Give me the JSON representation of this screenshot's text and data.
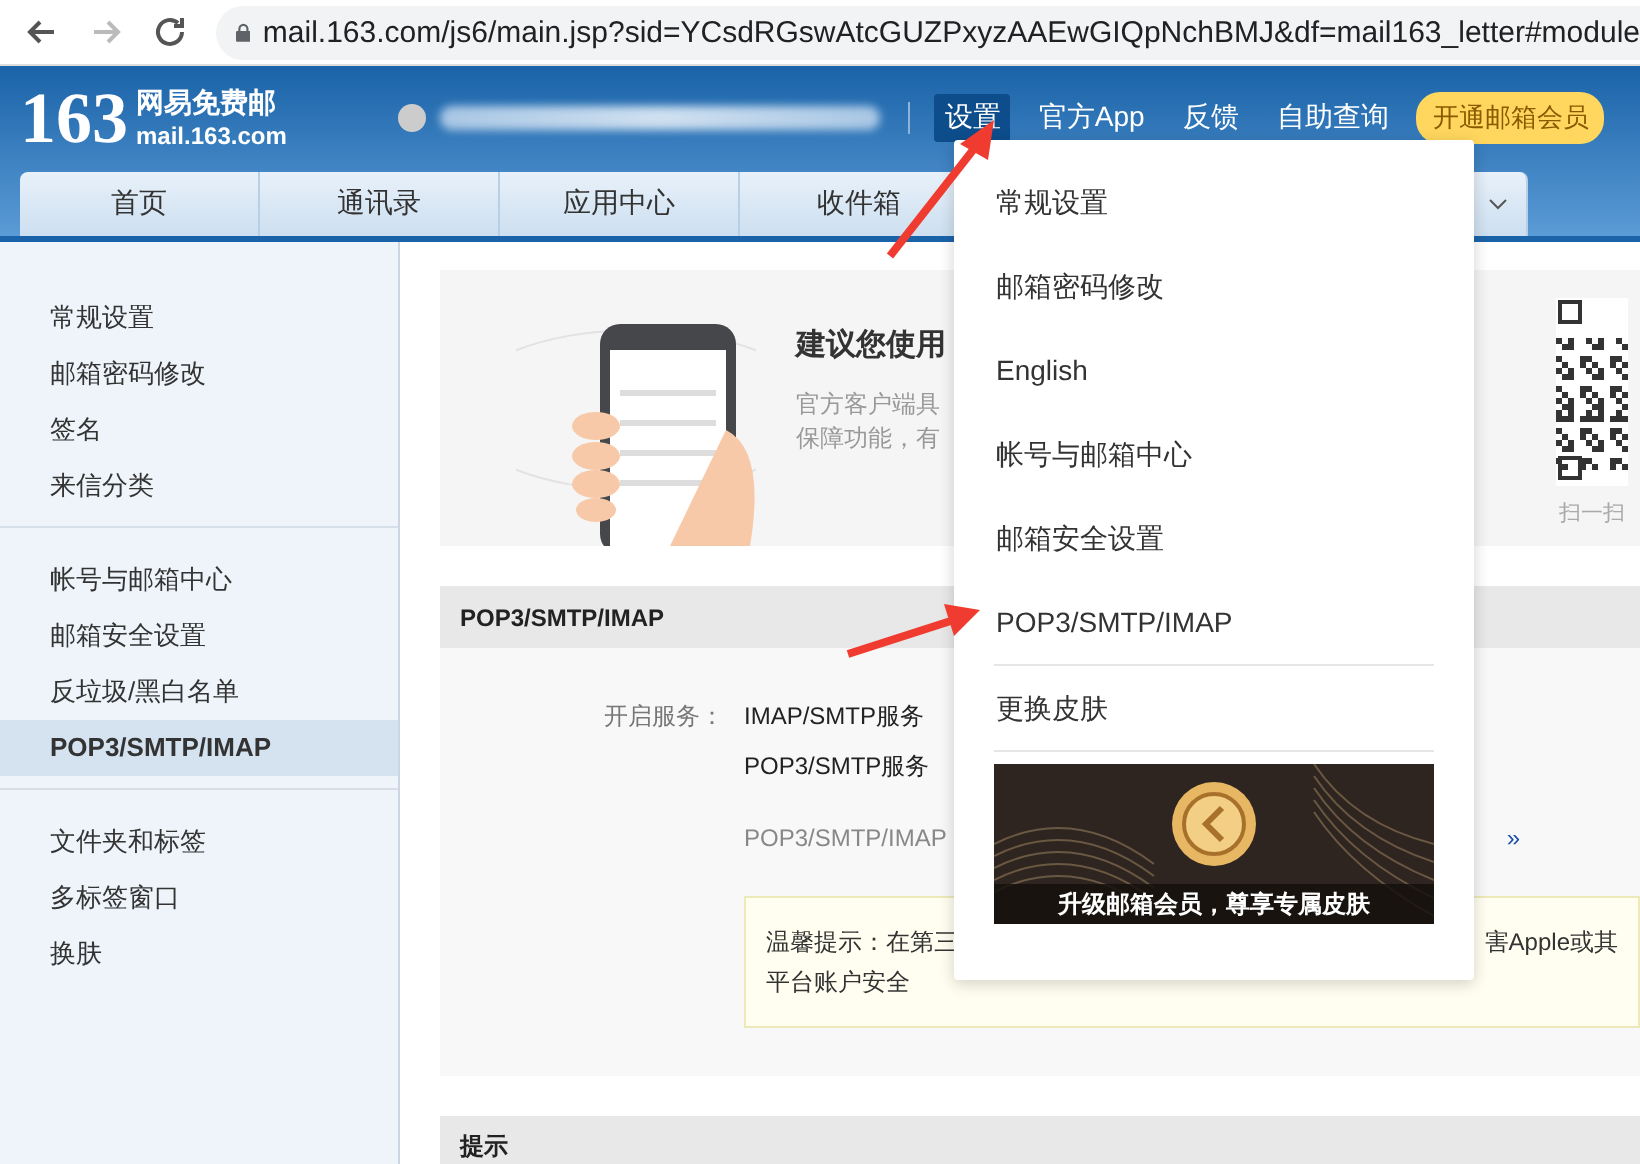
{
  "browser": {
    "url": "mail.163.com/js6/main.jsp?sid=YCsdRGswAtcGUZPxyzAAEwGIQpNchBMJ&df=mail163_letter#module",
    "forward_disabled": true
  },
  "header": {
    "logo_number": "163",
    "logo_name": "网易免费邮",
    "logo_domain": "mail.163.com",
    "nav": [
      {
        "label": "设置",
        "selected": true
      },
      {
        "label": "官方App",
        "selected": false
      },
      {
        "label": "反馈",
        "selected": false
      },
      {
        "label": "自助查询",
        "selected": false
      }
    ],
    "vip_button": "开通邮箱会员"
  },
  "tabs": [
    {
      "label": "首页"
    },
    {
      "label": "通讯录"
    },
    {
      "label": "应用中心"
    },
    {
      "label": "收件箱"
    }
  ],
  "sidebar": {
    "groups": [
      [
        {
          "label": "常规设置",
          "selected": false
        },
        {
          "label": "邮箱密码修改",
          "selected": false
        },
        {
          "label": "签名",
          "selected": false
        },
        {
          "label": "来信分类",
          "selected": false
        }
      ],
      [
        {
          "label": "帐号与邮箱中心",
          "selected": false
        },
        {
          "label": "邮箱安全设置",
          "selected": false
        },
        {
          "label": "反垃圾/黑白名单",
          "selected": false
        },
        {
          "label": "POP3/SMTP/IMAP",
          "selected": true
        }
      ],
      [
        {
          "label": "文件夹和标签",
          "selected": false
        },
        {
          "label": "多标签窗口",
          "selected": false
        },
        {
          "label": "换肤",
          "selected": false
        }
      ]
    ]
  },
  "promo": {
    "title": "建议您使用",
    "lines": [
      "官方客户端具",
      "保障功能，有"
    ],
    "qr_caption": "扫一扫"
  },
  "pop_section": {
    "title": "POP3/SMTP/IMAP",
    "label": "开启服务：",
    "services": [
      "IMAP/SMTP服务",
      "POP3/SMTP服务"
    ],
    "note": "POP3/SMTP/IMAP",
    "link": "»",
    "tip_left": "温馨提示：在第三",
    "tip_right": "害Apple或其",
    "tip_line2": "平台账户安全"
  },
  "tip_section": {
    "title": "提示"
  },
  "dropdown": {
    "groups": [
      [
        "常规设置",
        "邮箱密码修改",
        "English",
        "帐号与邮箱中心",
        "邮箱安全设置",
        "POP3/SMTP/IMAP"
      ],
      [
        "更换皮肤"
      ]
    ],
    "banner": "升级邮箱会员，尊享专属皮肤"
  }
}
